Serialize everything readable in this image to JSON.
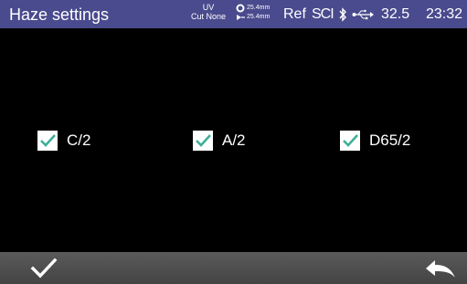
{
  "header": {
    "title": "Haze settings",
    "mode_line1": "UV",
    "mode_line2": "Cut None",
    "aperture_line1": "25.4mm",
    "aperture_line2": "25.4mm",
    "ref_label": "Ref",
    "sci_label": "SCI",
    "bluetooth_icon": "bluetooth-icon",
    "usb_icon": "usb-icon",
    "battery_value": "32.5",
    "clock": "23:32",
    "bar_color": "#4a4a8e"
  },
  "options": [
    {
      "label": "C/2",
      "checked": true
    },
    {
      "label": "A/2",
      "checked": true
    },
    {
      "label": "D65/2",
      "checked": true
    }
  ],
  "footer": {
    "confirm_icon": "checkmark-icon",
    "back_icon": "back-arrow-icon",
    "bar_color": "#4f4f4f"
  },
  "colors": {
    "checkmark": "#3fae9a",
    "background": "#000000"
  }
}
